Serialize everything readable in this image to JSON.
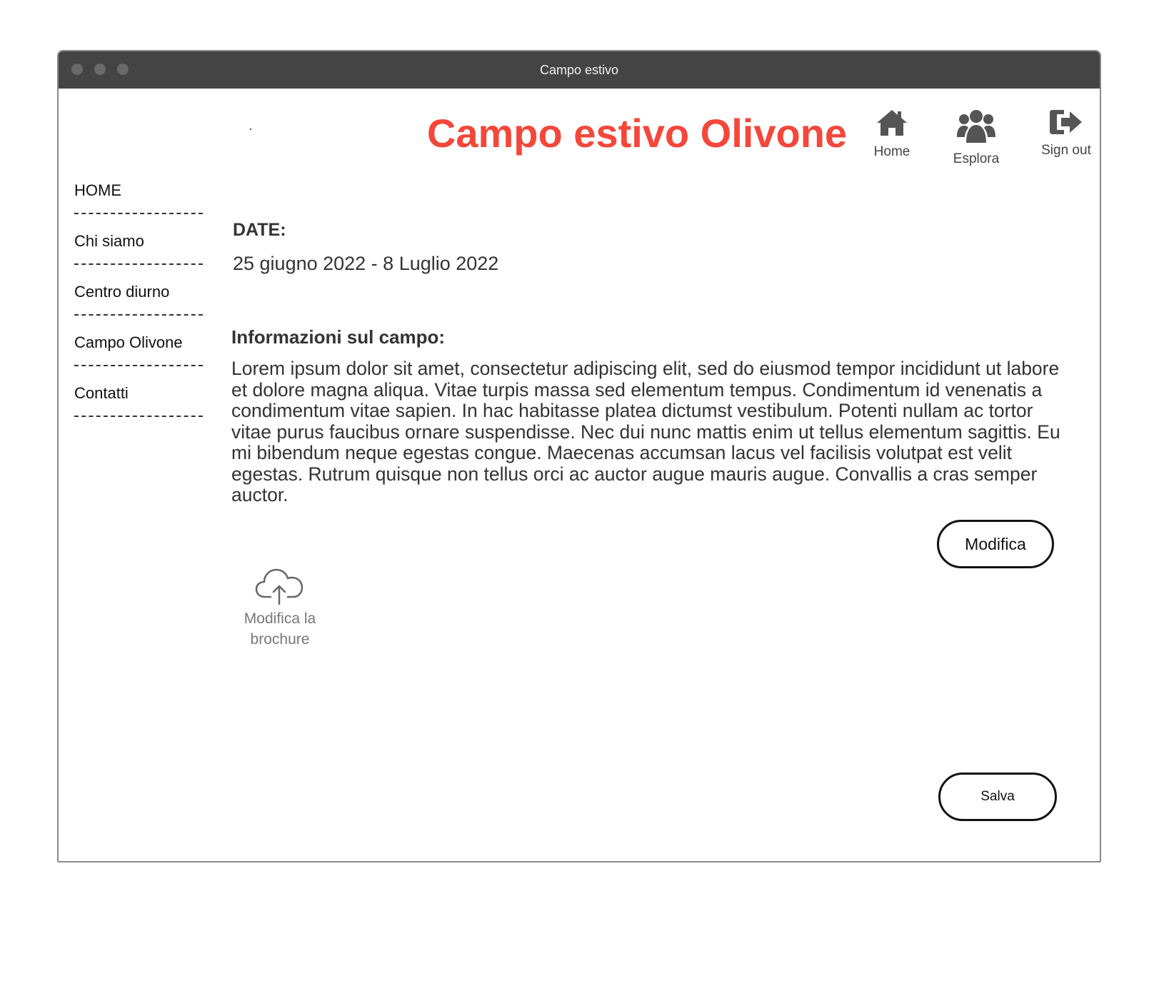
{
  "window": {
    "title": "Campo estivo"
  },
  "header": {
    "page_title": "Campo estivo Olivone",
    "nav": [
      {
        "label": "Home",
        "icon": "home-icon"
      },
      {
        "label": "Esplora",
        "icon": "users-icon"
      },
      {
        "label": "Sign out",
        "icon": "sign-out-icon"
      }
    ]
  },
  "sidebar": {
    "items": [
      {
        "label": "HOME"
      },
      {
        "label": "Chi siamo"
      },
      {
        "label": "Centro diurno"
      },
      {
        "label": "Campo Olivone"
      },
      {
        "label": "Contatti"
      }
    ]
  },
  "main": {
    "date_heading": "DATE:",
    "date_value": "25 giugno 2022 - 8 Luglio 2022",
    "info_heading": "Informazioni sul campo:",
    "info_text": "Lorem ipsum dolor sit amet, consectetur adipiscing elit, sed do eiusmod tempor incididunt ut labore et dolore magna aliqua. Vitae turpis massa sed elementum tempus. Condimentum id venenatis a condimentum vitae sapien. In hac habitasse platea dictumst vestibulum. Potenti nullam ac tortor vitae purus faucibus ornare suspendisse. Nec dui nunc mattis enim ut tellus elementum sagittis. Eu mi bibendum neque egestas congue. Maecenas accumsan lacus vel facilisis volutpat est velit egestas. Rutrum quisque non tellus orci ac auctor augue mauris augue. Convallis a cras semper auctor.",
    "edit_button": "Modifica",
    "upload_label_line1": "Modifica la",
    "upload_label_line2": "brochure",
    "upload_icon": "cloud-upload-icon",
    "save_button": "Salva"
  },
  "colors": {
    "title_accent": "#f4473a",
    "titlebar": "#444444",
    "icon_gray": "#555555"
  }
}
